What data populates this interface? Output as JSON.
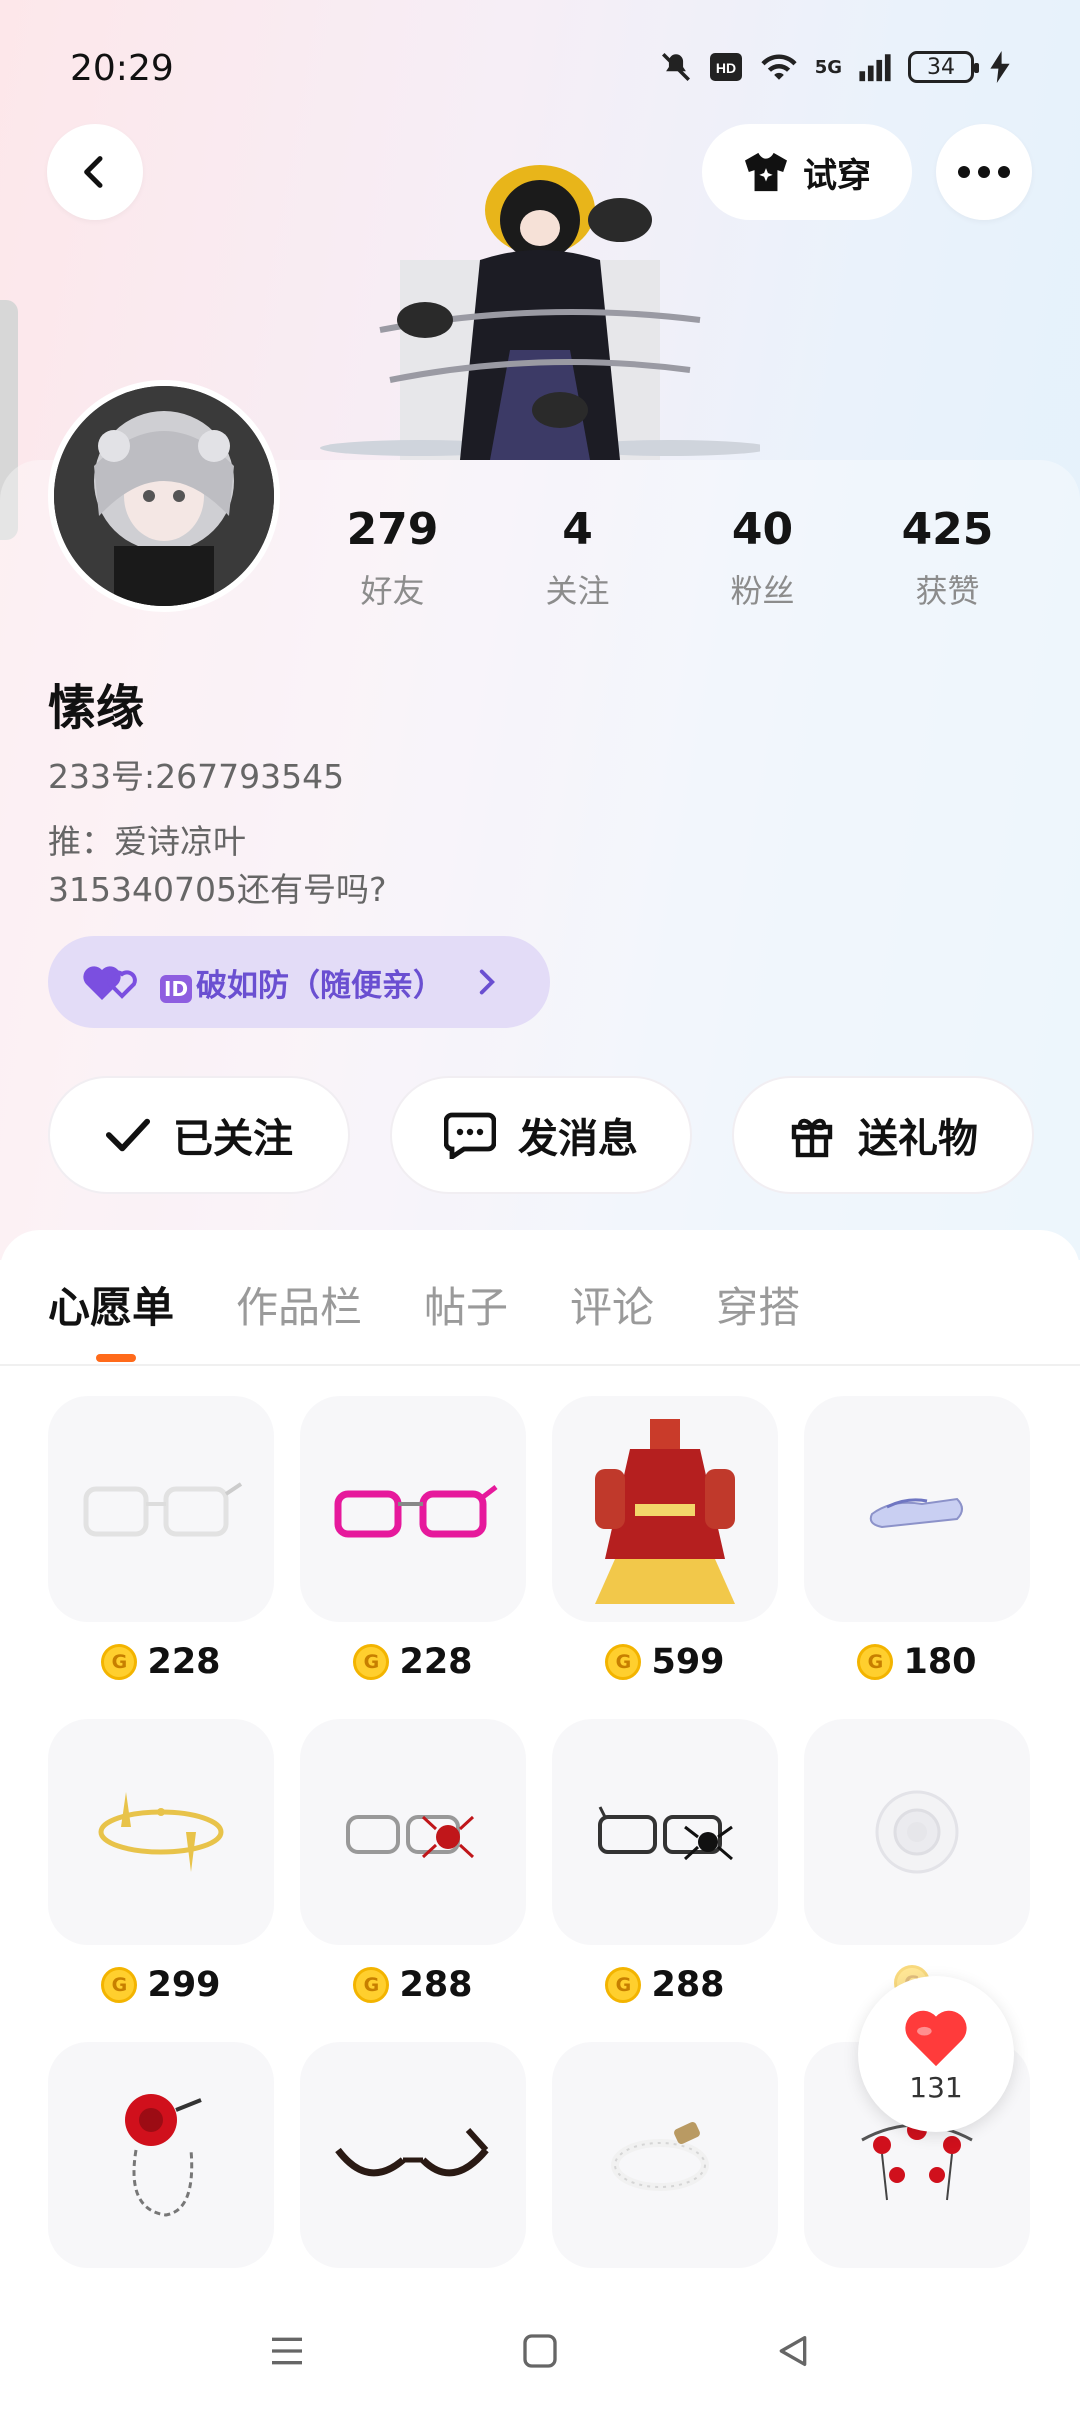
{
  "status_bar": {
    "time": "20:29",
    "network": "5G",
    "battery": "34"
  },
  "header": {
    "tryon_label": "试穿"
  },
  "stats": [
    {
      "value": "279",
      "label": "好友"
    },
    {
      "value": "4",
      "label": "关注"
    },
    {
      "value": "40",
      "label": "粉丝"
    },
    {
      "value": "425",
      "label": "获赞"
    }
  ],
  "profile": {
    "name": "愫缘",
    "uid": "233号:267793545",
    "bio": "推：爱诗凉叶\n315340705还有号吗?",
    "badge_id": "ID",
    "badge_text": "破如防（随便亲）"
  },
  "actions": {
    "follow": "已关注",
    "message": "发消息",
    "gift": "送礼物"
  },
  "tabs": [
    "心愿单",
    "作品栏",
    "帖子",
    "评论",
    "穿搭"
  ],
  "wishlist": [
    {
      "item": "white-glasses",
      "price": "228"
    },
    {
      "item": "pink-glasses",
      "price": "228"
    },
    {
      "item": "red-dress",
      "price": "599"
    },
    {
      "item": "shoes",
      "price": "180"
    },
    {
      "item": "gold-halo",
      "price": "299"
    },
    {
      "item": "spider-glasses",
      "price": "288"
    },
    {
      "item": "black-spider-glasses",
      "price": "288"
    },
    {
      "item": "white-flower",
      "price": ""
    },
    {
      "item": "red-rose-chain",
      "price": ""
    },
    {
      "item": "black-glasses",
      "price": ""
    },
    {
      "item": "pearl-bracelet",
      "price": ""
    },
    {
      "item": "red-necklace",
      "price": ""
    }
  ],
  "like_button": {
    "count": "131"
  },
  "colors": {
    "accent": "#ff6a1a",
    "badge_bg": "#e3dcf7",
    "badge_text": "#6a4fd1",
    "coin": "#ffcf2e"
  }
}
